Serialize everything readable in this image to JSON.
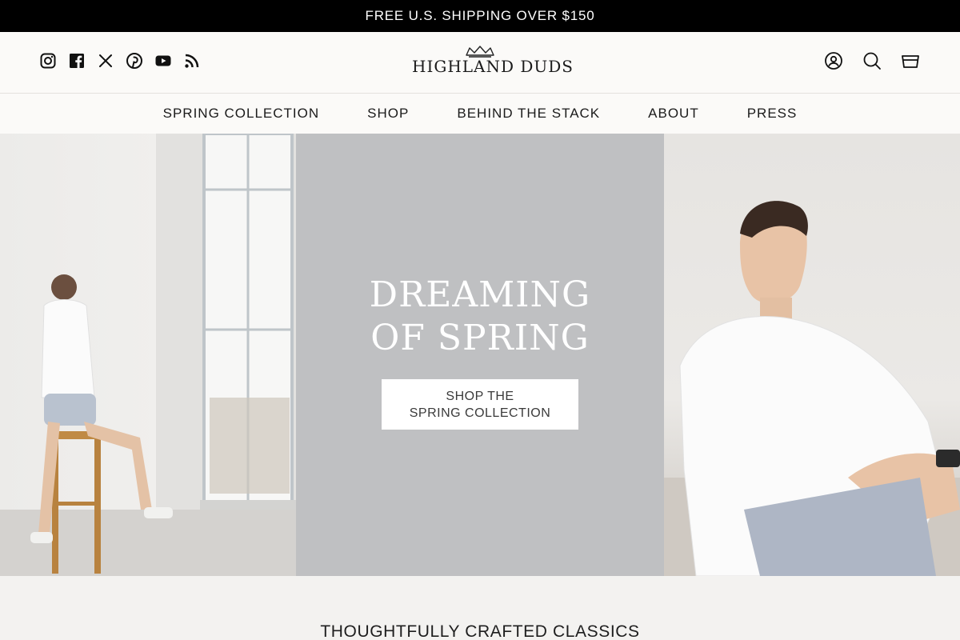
{
  "announcement": "FREE U.S. SHIPPING OVER $150",
  "brand": {
    "name": "HIGHLAND DUDS"
  },
  "social_icons": [
    "instagram-icon",
    "facebook-icon",
    "x-icon",
    "pinterest-icon",
    "youtube-icon",
    "rss-icon"
  ],
  "utility_icons": [
    "account-icon",
    "search-icon",
    "cart-icon"
  ],
  "nav": {
    "items": [
      "SPRING COLLECTION",
      "SHOP",
      "BEHIND THE STACK",
      "ABOUT",
      "PRESS"
    ]
  },
  "hero": {
    "title_line1": "DREAMING",
    "title_line2": "OF SPRING",
    "button_line1": "SHOP THE",
    "button_line2": "SPRING COLLECTION"
  },
  "section": {
    "title": "THOUGHTFULLY CRAFTED CLASSICS"
  },
  "colors": {
    "announcement_bg": "#000000",
    "header_bg": "#fbfaf8",
    "hero_panel": "#bfc0c2",
    "page_bg": "#f3f2f0"
  }
}
